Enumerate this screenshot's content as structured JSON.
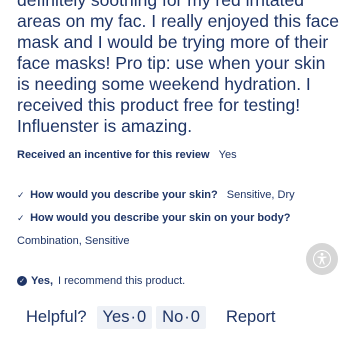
{
  "review": {
    "body": "definitely soothing for my red irritated areas on my fac. I really enjoyed this face mask and I would be trying more of their face masks! Pro tip: use when your skin is needing some weekend hydration. I received this product free for testing! Influenster is amazing."
  },
  "incentive": {
    "label": "Received an incentive for this review",
    "value": "Yes"
  },
  "questions": [
    {
      "question": "How would you describe your skin?",
      "answer": "Sensitive,  Dry"
    },
    {
      "question": "How would you describe your skin on your body?",
      "answer": "Combination,  Sensitive"
    }
  ],
  "recommend": {
    "yes_label": "Yes,",
    "text": "I recommend this product."
  },
  "helpful": {
    "label": "Helpful?",
    "yes_label": "Yes",
    "yes_count": "0",
    "no_label": "No",
    "no_count": "0",
    "report_label": "Report"
  },
  "icons": {
    "question_bullet": "checkmark-icon",
    "recommend_check": "check-circle-icon",
    "floating_button": "accessibility-icon"
  }
}
